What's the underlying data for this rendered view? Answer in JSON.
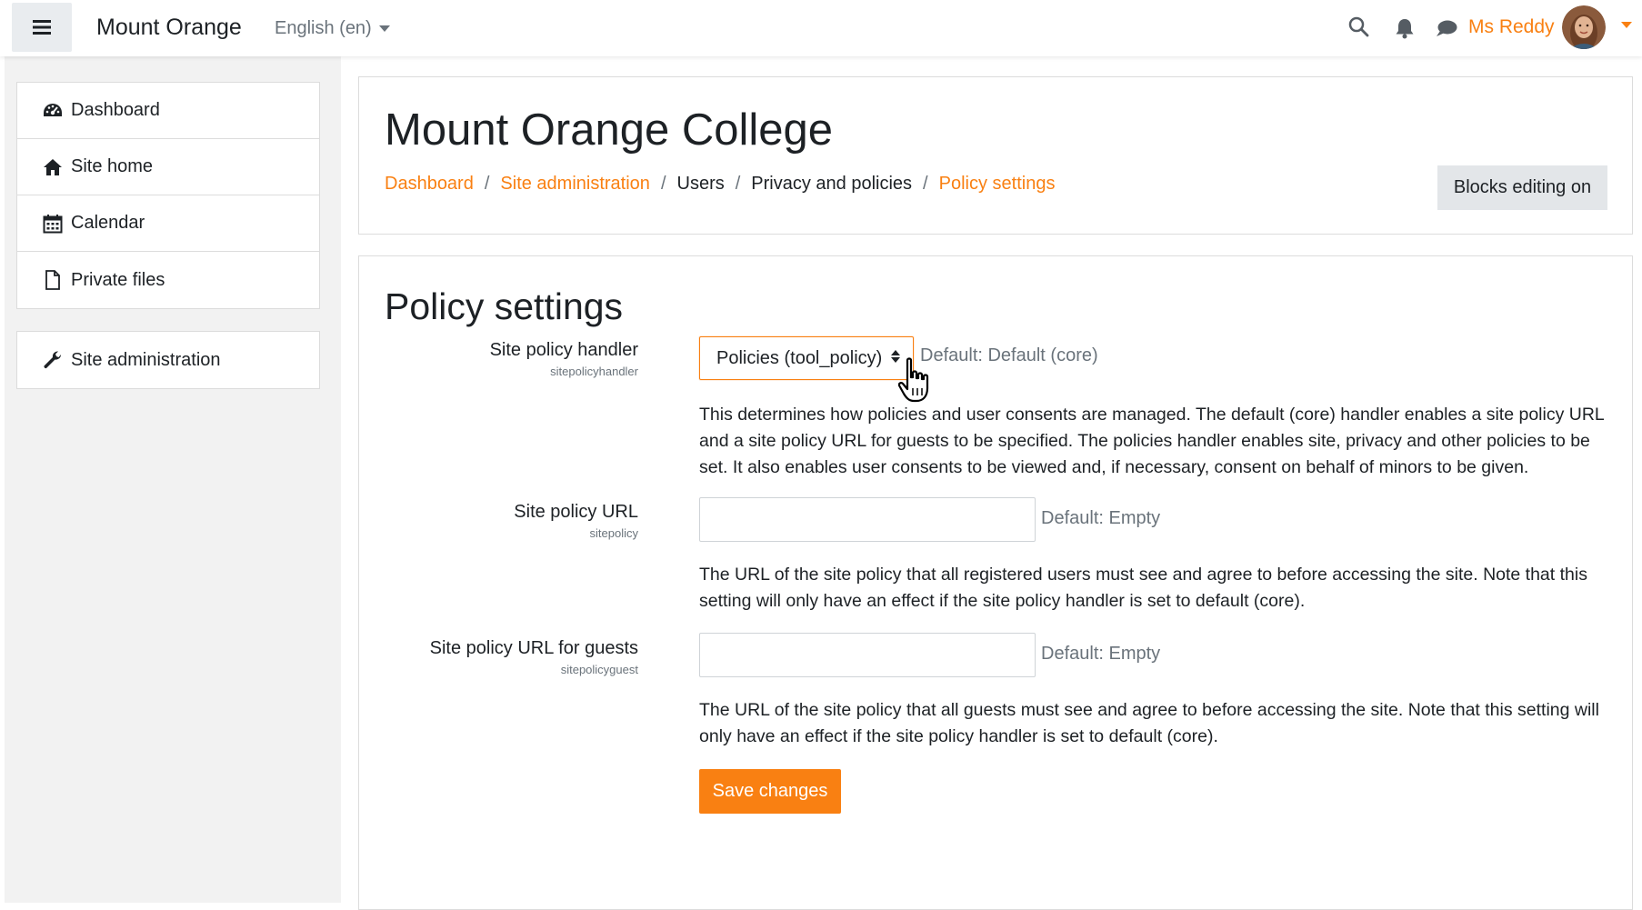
{
  "navbar": {
    "brand": "Mount Orange",
    "language": "English (en)",
    "user_name": "Ms Reddy",
    "icons": [
      "menu-icon",
      "search-icon",
      "bell-icon",
      "chat-icon"
    ]
  },
  "sidebar": {
    "items": [
      {
        "label": "Dashboard",
        "icon": "dashboard-gauge-icon"
      },
      {
        "label": "Site home",
        "icon": "home-icon"
      },
      {
        "label": "Calendar",
        "icon": "calendar-icon"
      },
      {
        "label": "Private files",
        "icon": "file-icon"
      }
    ],
    "admin": {
      "label": "Site administration",
      "icon": "wrench-icon"
    }
  },
  "header": {
    "title": "Mount Orange College",
    "breadcrumb": [
      {
        "label": "Dashboard",
        "link": true
      },
      {
        "label": "Site administration",
        "link": true
      },
      {
        "label": "Users",
        "link": false
      },
      {
        "label": "Privacy and policies",
        "link": false
      },
      {
        "label": "Policy settings",
        "link": true
      }
    ],
    "separator": "/",
    "blocks_button": "Blocks editing on"
  },
  "main": {
    "heading": "Policy settings",
    "settings": [
      {
        "label": "Site policy handler",
        "name": "sitepolicyhandler",
        "type": "select",
        "value": "Policies (tool_policy)",
        "default": "Default: Default (core)",
        "description": "This determines how policies and user consents are managed. The default (core) handler enables a site policy URL and a site policy URL for guests to be specified. The policies handler enables site, privacy and other policies to be set. It also enables user consents to be viewed and, if necessary, consent on behalf of minors to be given."
      },
      {
        "label": "Site policy URL",
        "name": "sitepolicy",
        "type": "text",
        "value": "",
        "default": "Default: Empty",
        "description": "The URL of the site policy that all registered users must see and agree to before accessing the site. Note that this setting will only have an effect if the site policy handler is set to default (core)."
      },
      {
        "label": "Site policy URL for guests",
        "name": "sitepolicyguest",
        "type": "text",
        "value": "",
        "default": "Default: Empty",
        "description": "The URL of the site policy that all guests must see and agree to before accessing the site. Note that this setting will only have an effect if the site policy handler is set to default (core)."
      }
    ],
    "save_button": "Save changes"
  },
  "colors": {
    "accent": "#f98012",
    "muted_text": "#6a737b",
    "drawer_bg": "#f2f2f2",
    "button_secondary_bg": "#e3e6e9"
  }
}
